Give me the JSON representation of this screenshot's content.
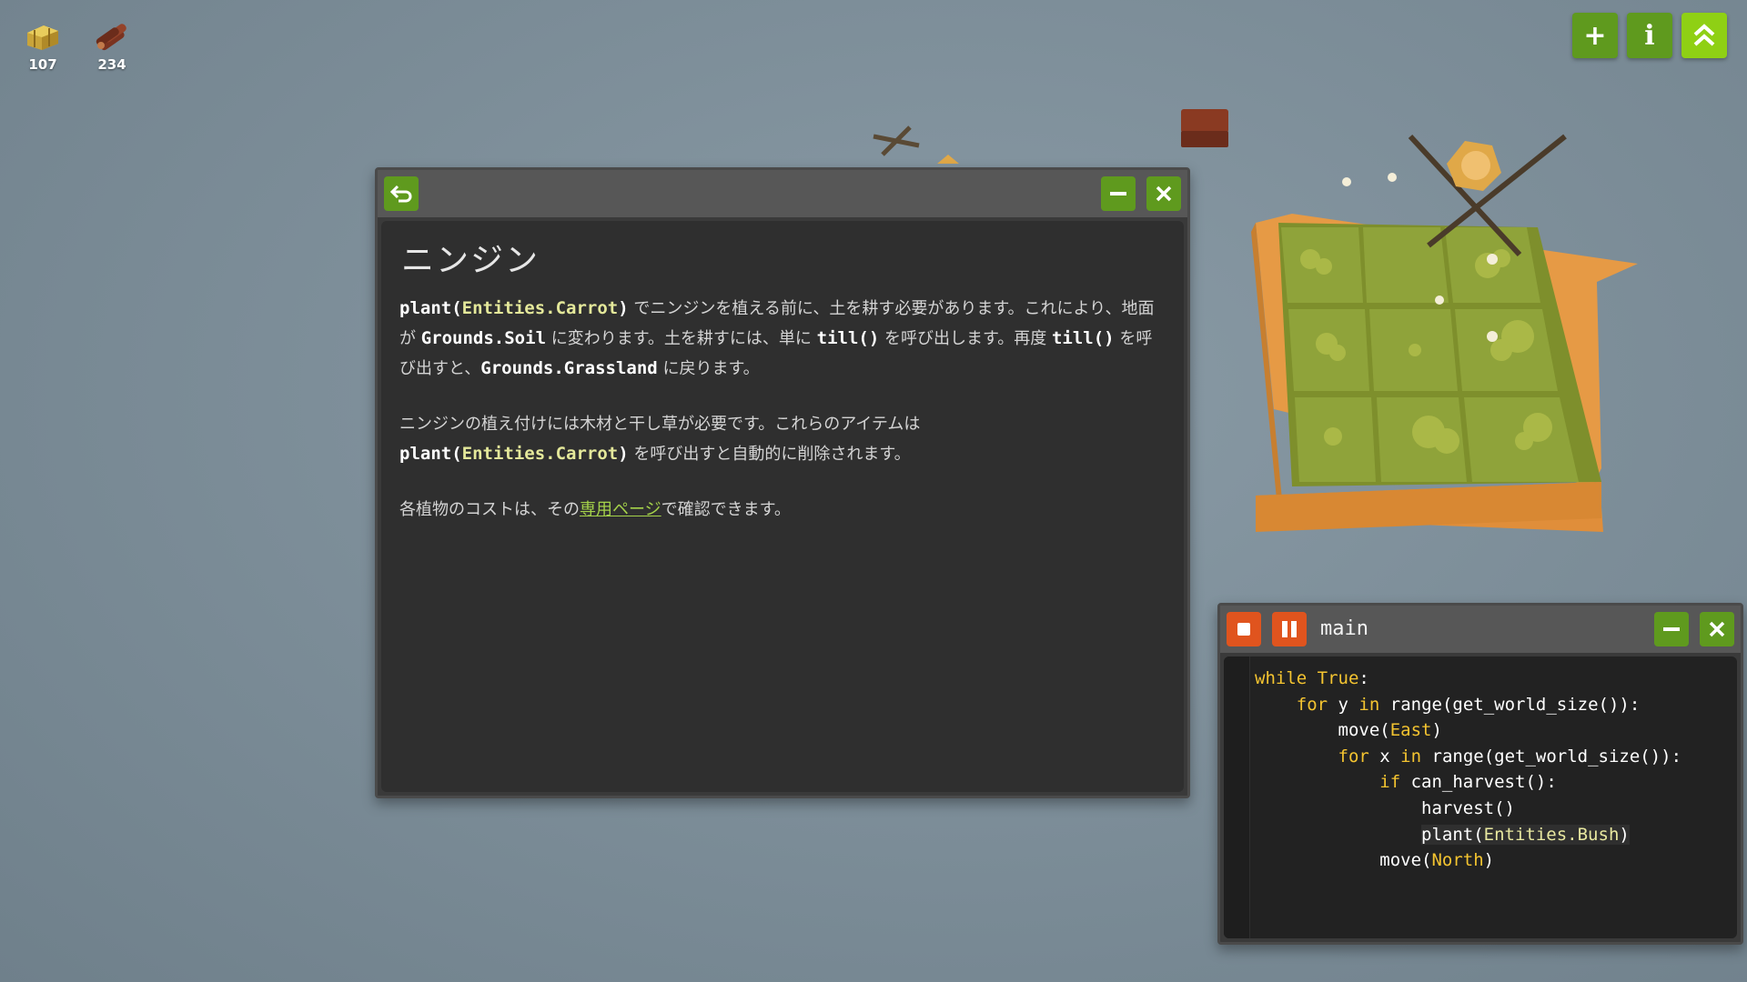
{
  "resources": [
    {
      "name": "hay",
      "icon": "hay-bale-icon",
      "count": "107",
      "color": "#d9b945"
    },
    {
      "name": "wood",
      "icon": "wood-logs-icon",
      "count": "234",
      "color": "#8a3a22"
    }
  ],
  "top_buttons": [
    {
      "icon": "plus-icon",
      "glyph": "+"
    },
    {
      "icon": "info-icon",
      "glyph": "i"
    },
    {
      "icon": "double-chevron-up-icon"
    }
  ],
  "docs": {
    "title": "ニンジン",
    "p1": {
      "c1a": "plant(",
      "c1b": "Entities.Carrot",
      "c1c": ")",
      "t1": " でニンジンを植える前に、土を耕す必要があります。これにより、地面が ",
      "c2": "Grounds.Soil",
      "t2": " に変わります。土を耕すには、単に ",
      "c3": "till()",
      "t3": " を呼び出します。再度 ",
      "c4": "till()",
      "t4": " を呼び出すと、",
      "c5": "Grounds.Grassland",
      "t5": " に戻ります。"
    },
    "p2": {
      "t1": "ニンジンの植え付けには木材と干し草が必要です。これらのアイテムは",
      "c1a": "plant(",
      "c1b": "Entities.Carrot",
      "c1c": ")",
      "t2": " を呼び出すと自動的に削除されます。"
    },
    "p3": {
      "t1": "各植物のコストは、その",
      "link": "専用ページ",
      "t2": "で確認できます。"
    }
  },
  "code_window": {
    "title": "main",
    "lines": [
      [
        {
          "t": "while ",
          "c": "kw"
        },
        {
          "t": "True",
          "c": "kw"
        },
        {
          "t": ":",
          "c": ""
        }
      ],
      [
        {
          "t": "    ",
          "c": ""
        },
        {
          "t": "for",
          "c": "kw"
        },
        {
          "t": " y ",
          "c": ""
        },
        {
          "t": "in",
          "c": "kw"
        },
        {
          "t": " range(get_world_size()):",
          "c": ""
        }
      ],
      [
        {
          "t": "        move(",
          "c": ""
        },
        {
          "t": "East",
          "c": "kw"
        },
        {
          "t": ")",
          "c": ""
        }
      ],
      [
        {
          "t": "        ",
          "c": ""
        },
        {
          "t": "for",
          "c": "kw"
        },
        {
          "t": " x ",
          "c": ""
        },
        {
          "t": "in",
          "c": "kw"
        },
        {
          "t": " range(get_world_size()):",
          "c": ""
        }
      ],
      [
        {
          "t": "            ",
          "c": ""
        },
        {
          "t": "if",
          "c": "kw"
        },
        {
          "t": " can_harvest():",
          "c": ""
        }
      ],
      [
        {
          "t": "                harvest()",
          "c": ""
        }
      ],
      [
        {
          "t": "                ",
          "c": ""
        },
        {
          "t": "plant(",
          "c": "hl"
        },
        {
          "t": "Entities.Bush",
          "c": "ent hl"
        },
        {
          "t": ")",
          "c": "hl"
        }
      ],
      [
        {
          "t": "            move(",
          "c": ""
        },
        {
          "t": "North",
          "c": "kw"
        },
        {
          "t": ")",
          "c": ""
        }
      ]
    ]
  }
}
